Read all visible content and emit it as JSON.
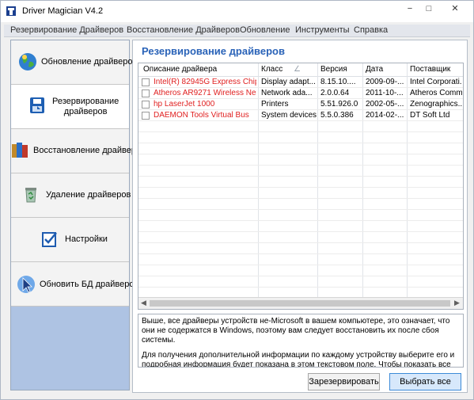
{
  "window": {
    "title": "Driver Magician V4.2",
    "controls": {
      "minimize": "−",
      "maximize": "□",
      "close": "✕"
    }
  },
  "menu": [
    "Резервирование Драйверов",
    "Восстановление Драйверов",
    "Обновление",
    "Инструменты",
    "Справка"
  ],
  "sidebar": {
    "items": [
      {
        "label": "Обновление драйверов",
        "icon": "globe-update-icon"
      },
      {
        "label": "Резервирование\nдрайверов",
        "icon": "backup-disk-icon"
      },
      {
        "label": "Восстановление драйверов",
        "icon": "restore-books-icon"
      },
      {
        "label": "Удаление драйверов",
        "icon": "recycle-bin-icon"
      },
      {
        "label": "Настройки",
        "icon": "settings-checklist-icon"
      },
      {
        "label": "Обновить БД драйверов",
        "icon": "cursor-db-icon"
      }
    ]
  },
  "main": {
    "title": "Резервирование драйверов",
    "table": {
      "columns": [
        "Описание драйвера",
        "Класс",
        "Версия",
        "Дата",
        "Поставщик"
      ],
      "rows": [
        {
          "name": "Intel(R) 82945G Express Chip...",
          "class": "Display adapt...",
          "version": "8.15.10....",
          "date": "2009-09-...",
          "vendor": "Intel Corporati..."
        },
        {
          "name": "Atheros AR9271 Wireless Ne...",
          "class": "Network ada...",
          "version": "2.0.0.64",
          "date": "2011-10-...",
          "vendor": "Atheros Comm..."
        },
        {
          "name": "hp LaserJet 1000",
          "class": "Printers",
          "version": "5.51.926.0",
          "date": "2002-05-...",
          "vendor": "Zenographics..."
        },
        {
          "name": "DAEMON Tools Virtual Bus",
          "class": "System devices",
          "version": "5.5.0.386",
          "date": "2014-02-...",
          "vendor": "DT Soft Ltd"
        }
      ]
    },
    "description": {
      "p1": "Выше, все драйверы устройств не-Microsoft в вашем компьютере, это означает, что они не содержатся в Windows, поэтому вам следует восстановить их после сбоя системы.",
      "p2": "Для получения дополнительной информации по каждому устройству выберите его и подробная информация будет показана в этом текстовом поле. Чтобы показать все драйверы устройств вашего компьютера, нажмите «Резервирование/поиск всех драйверов» в строке меню."
    },
    "buttons": {
      "backup": "Зарезервировать",
      "select_all": "Выбрать все"
    }
  },
  "colors": {
    "accent": "#2a63b8",
    "driver_text": "#e02020",
    "sidebar_bg": "#aec3e3"
  }
}
